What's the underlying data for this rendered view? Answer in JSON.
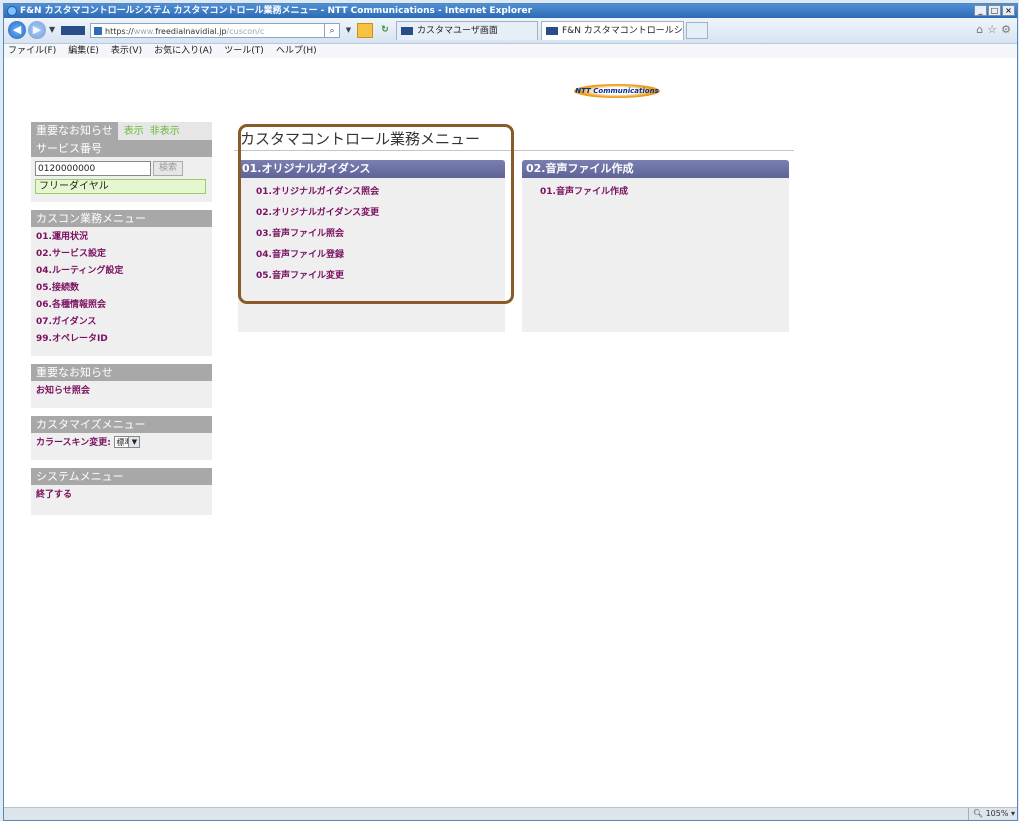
{
  "browser": {
    "window_title": "F&N カスタマコントロールシステム カスタマコントロール業務メニュー - NTT Communications - Internet Explorer",
    "address_prefix": "https://",
    "address_grey": "www.",
    "address_host": "freedialnavidial.jp",
    "address_path": "/cuscon/c",
    "tabs": [
      {
        "label": "カスタマユーザ画面"
      },
      {
        "label": "F&N カスタマコントロールシ..."
      }
    ],
    "menu": [
      "ファイル(F)",
      "編集(E)",
      "表示(V)",
      "お気に入り(A)",
      "ツール(T)",
      "ヘルプ(H)"
    ],
    "zoom": "105%"
  },
  "logo_text": "NTT Communications",
  "sidebar": {
    "notice_header": "重要なお知らせ",
    "notice_show": "表示",
    "notice_hide": "非表示",
    "service_header": "サービス番号",
    "service_number": "0120000000",
    "search_label": "検索",
    "service_type": "フリーダイヤル",
    "menu_header": "カスコン業務メニュー",
    "menu_items": [
      {
        "label": "01.運用状況"
      },
      {
        "label": "02.サービス設定"
      },
      {
        "label": "04.ルーティング設定"
      },
      {
        "label": "05.接続数"
      },
      {
        "label": "06.各種情報照会"
      },
      {
        "label": "07.ガイダンス"
      },
      {
        "label": "99.オペレータID"
      }
    ],
    "notice2_header": "重要なお知らせ",
    "notice2_link": "お知らせ照会",
    "customize_header": "カスタマイズメニュー",
    "skin_label": "カラースキン変更:",
    "skin_value": "標準",
    "system_header": "システムメニュー",
    "exit_label": "終了する"
  },
  "main": {
    "title": "カスタマコントロール業務メニュー",
    "panels": [
      {
        "header": "01.オリジナルガイダンス",
        "links": [
          {
            "label": "01.オリジナルガイダンス照会"
          },
          {
            "label": "02.オリジナルガイダンス変更"
          },
          {
            "label": "03.音声ファイル照会"
          },
          {
            "label": "04.音声ファイル登録"
          },
          {
            "label": "05.音声ファイル変更"
          }
        ]
      },
      {
        "header": "02.音声ファイル作成",
        "links": [
          {
            "label": "01.音声ファイル作成"
          }
        ]
      }
    ]
  }
}
